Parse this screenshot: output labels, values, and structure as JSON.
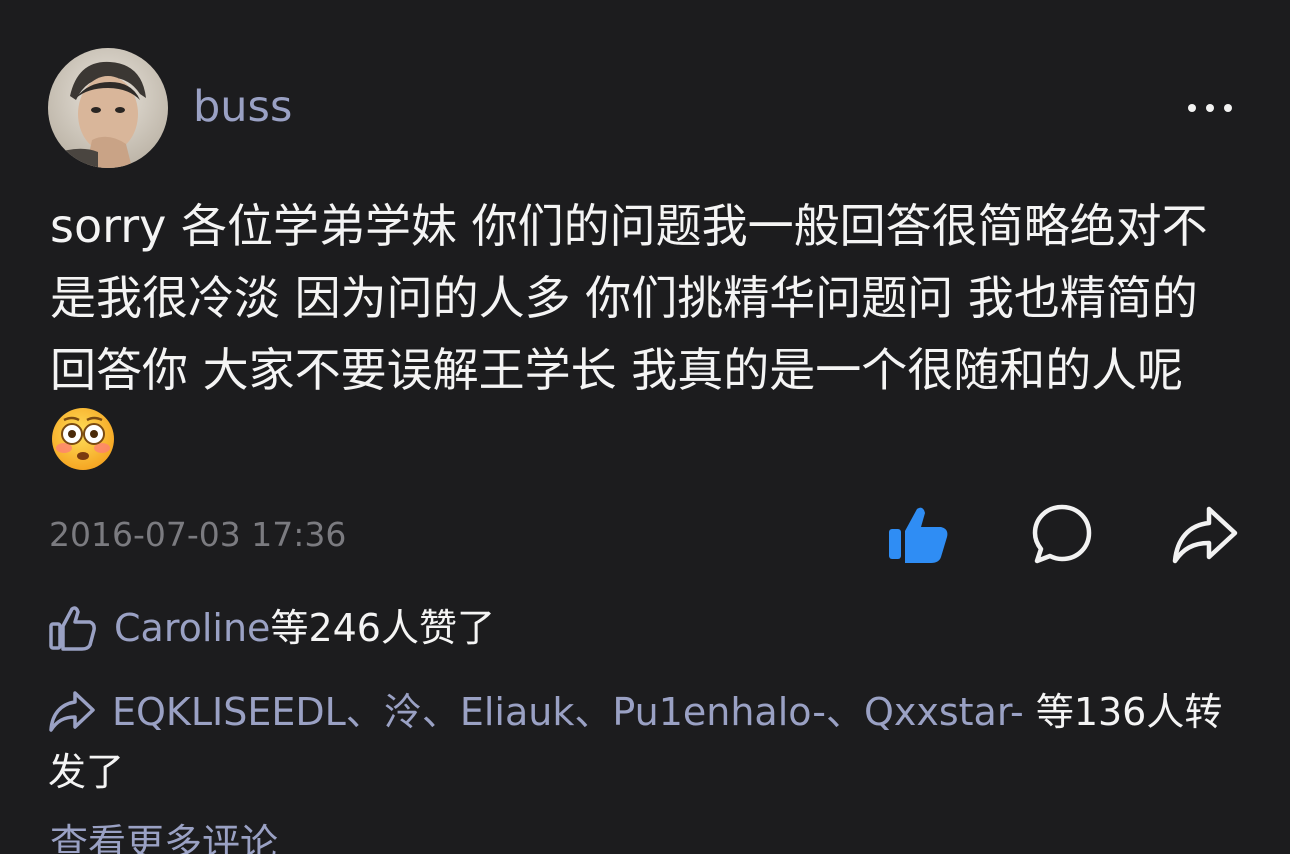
{
  "post": {
    "username": "buss",
    "content": "sorry 各位学弟学妹 你们的问题我一般回答很简略绝对不是我很冷淡 因为问的人多 你们挑精华问题问 我也精简的回答你 大家不要误解王学长 我真的是一个很随和的人呢",
    "emoji": "flushed-face",
    "timestamp": "2016-07-03 17:36"
  },
  "likes": {
    "name": "Caroline",
    "suffix": " 等246人赞了"
  },
  "reposts": {
    "names": [
      "EQKLISEEDL",
      "泠",
      "Eliauk",
      "Pu1enhalo-",
      "Qxxstar-"
    ],
    "separator": "、",
    "suffix": " 等136人转发了"
  },
  "more_comments": "查看更多评论",
  "colors": {
    "background": "#1c1c1e",
    "link": "#9aa1c4",
    "like_active": "#2f8df4",
    "muted": "#7b7b80"
  }
}
